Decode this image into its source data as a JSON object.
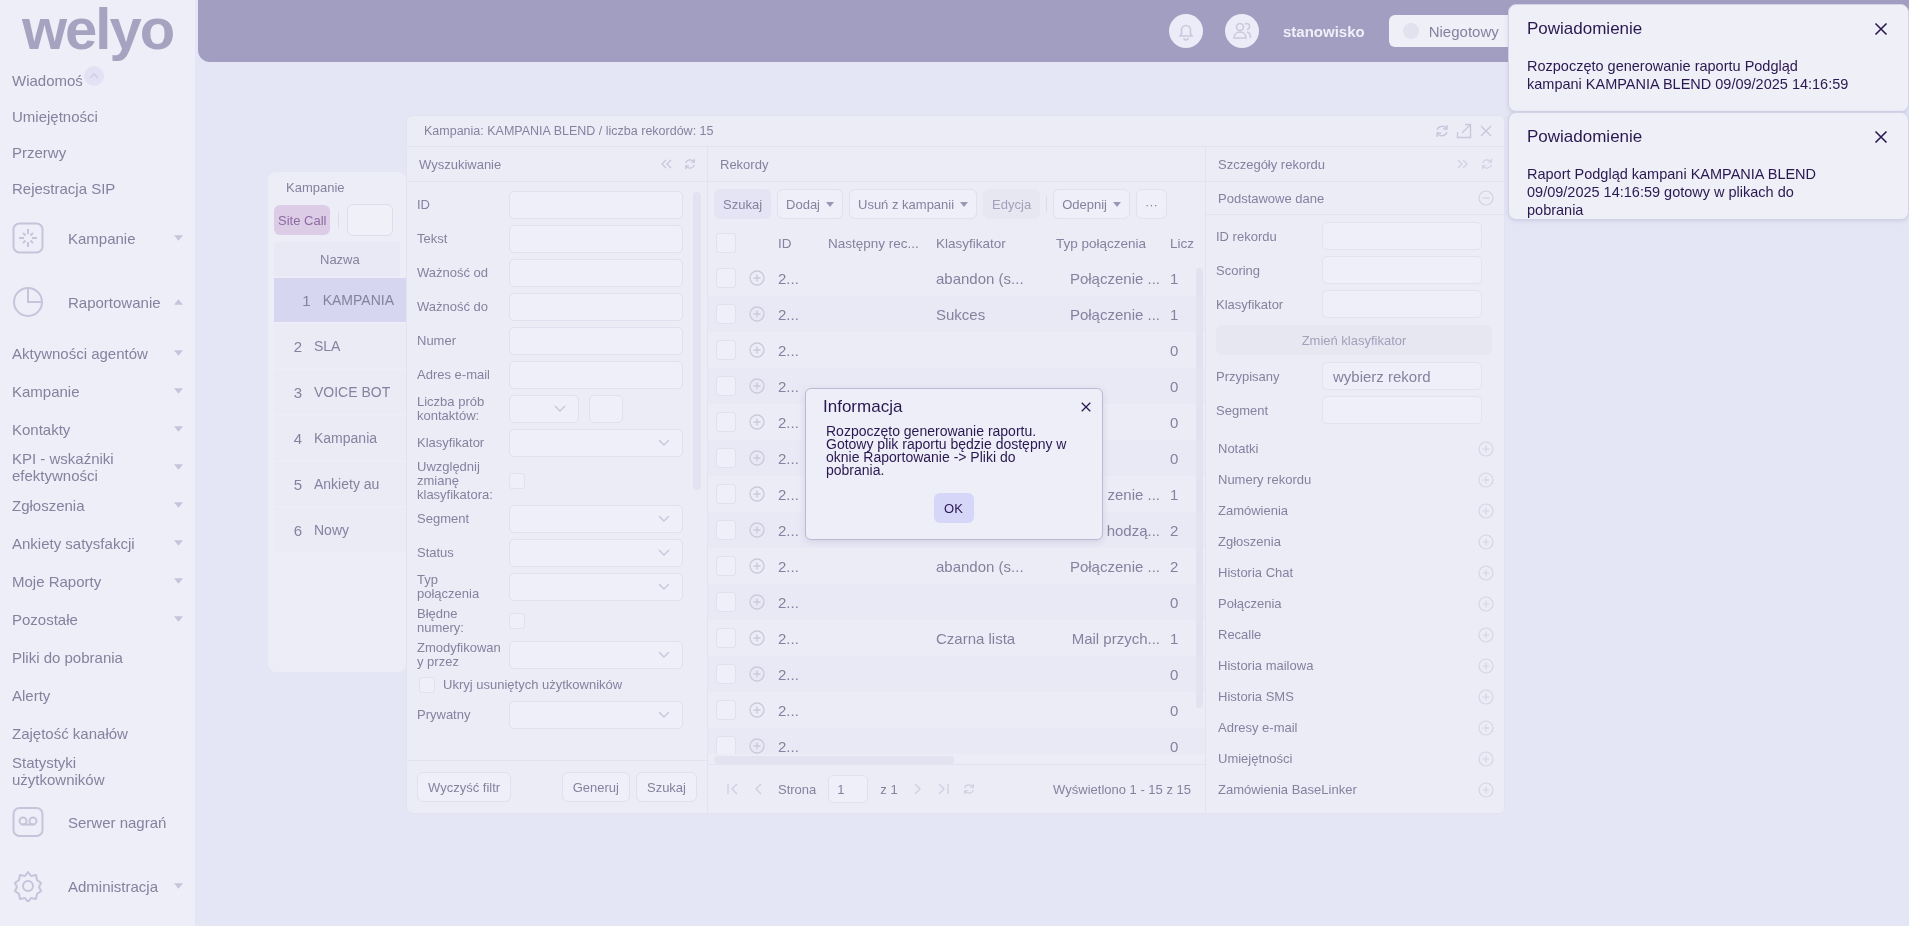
{
  "logo": "welyo",
  "sidebar": {
    "items": [
      {
        "label": "Wiadomoś",
        "kind": "link"
      },
      {
        "label": "Umiejętności",
        "kind": "link"
      },
      {
        "label": "Przerwy",
        "kind": "link"
      },
      {
        "label": "Rejestracja SIP",
        "kind": "link"
      },
      {
        "label": "Kampanie",
        "kind": "group",
        "expanded": false
      },
      {
        "label": "Raportowanie",
        "kind": "group",
        "expanded": true,
        "children": [
          {
            "label": "Aktywności agentów",
            "kind": "menu",
            "expanded": false
          },
          {
            "label": "Kampanie",
            "kind": "menu",
            "expanded": false
          },
          {
            "label": "Kontakty",
            "kind": "menu",
            "expanded": false
          },
          {
            "label": "KPI - wskaźniki efektywności",
            "kind": "menu",
            "expanded": false
          },
          {
            "label": "Zgłoszenia",
            "kind": "menu",
            "expanded": false
          },
          {
            "label": "Ankiety satysfakcji",
            "kind": "menu",
            "expanded": false
          },
          {
            "label": "Moje Raporty",
            "kind": "menu",
            "expanded": false
          },
          {
            "label": "Pozostałe",
            "kind": "menu",
            "expanded": false
          },
          {
            "label": "Pliki do pobrania",
            "kind": "link"
          },
          {
            "label": "Alerty",
            "kind": "link"
          },
          {
            "label": "Zajętość kanałów",
            "kind": "link"
          },
          {
            "label": "Statystyki użytkowników",
            "kind": "link"
          }
        ]
      },
      {
        "label": "Serwer nagrań",
        "kind": "group"
      },
      {
        "label": "Administracja",
        "kind": "group",
        "expanded": false
      }
    ]
  },
  "topbar": {
    "workstation": "stanowisko",
    "status": "Niegotowy"
  },
  "campaigns_panel": {
    "title": "Kampanie",
    "button": "Site Call",
    "column": "Nazwa",
    "rows": [
      {
        "number": "1",
        "name": "KAMPANIA",
        "selected": true
      },
      {
        "number": "2",
        "name": "SLA",
        "selected": false
      },
      {
        "number": "3",
        "name": "VOICE BOT",
        "selected": false
      },
      {
        "number": "4",
        "name": "Kampania",
        "selected": false
      },
      {
        "number": "5",
        "name": "Ankiety au",
        "selected": false
      },
      {
        "number": "6",
        "name": "Nowy",
        "selected": false
      }
    ]
  },
  "window": {
    "title": "Kampania: KAMPANIA BLEND / liczba rekordów: 15",
    "search": {
      "title": "Wyszukiwanie",
      "fields": [
        {
          "label": "ID",
          "kind": "text"
        },
        {
          "label": "Tekst",
          "kind": "text"
        },
        {
          "label": "Ważność od",
          "kind": "text"
        },
        {
          "label": "Ważność do",
          "kind": "text"
        },
        {
          "label": "Numer",
          "kind": "text"
        },
        {
          "label": "Adres e-mail",
          "kind": "text"
        },
        {
          "label": "Liczba prób kontaktów:",
          "kind": "pair"
        },
        {
          "label": "Klasyfikator",
          "kind": "select"
        },
        {
          "label": "Uwzględnij zmianę klasyfikatora:",
          "kind": "checkbox",
          "checked": false
        },
        {
          "label": "Segment",
          "kind": "select"
        },
        {
          "label": "Status",
          "kind": "select"
        },
        {
          "label": "Typ połączenia",
          "kind": "select"
        },
        {
          "label": "Błędne numery:",
          "kind": "checkbox",
          "checked": false
        },
        {
          "label": "Zmodyfikowany przez",
          "kind": "select"
        },
        {
          "label": "Ukryj usuniętych użytkowników",
          "kind": "check_row",
          "checked": false
        },
        {
          "label": "Prywatny",
          "kind": "select"
        }
      ],
      "buttons": [
        "Wyczyść filtr",
        "Generuj",
        "Szukaj"
      ]
    },
    "records": {
      "title": "Rekordy",
      "toolbar": [
        {
          "label": "Szukaj",
          "kind": "primary",
          "disabled": false
        },
        {
          "label": "Dodaj",
          "kind": "dropdown",
          "disabled": false
        },
        {
          "label": "Usuń z kampanii",
          "kind": "dropdown",
          "disabled": false
        },
        {
          "label": "Edycja",
          "kind": "plain",
          "disabled": true
        },
        {
          "kind": "separator"
        },
        {
          "label": "Odepnij",
          "kind": "dropdown",
          "disabled": false
        },
        {
          "label": "···",
          "kind": "plain",
          "disabled": false
        }
      ],
      "select_all_checked": false,
      "columns": [
        "ID",
        "Następny rec...",
        "Klasyfikator",
        "Typ połączenia",
        "Licz"
      ],
      "rows": [
        {
          "checked": false,
          "id": "2...",
          "classifier": "abandon (s...",
          "type": "Połączenie ...",
          "count": "1"
        },
        {
          "checked": false,
          "id": "2...",
          "classifier": "Sukces",
          "type": "Połączenie ...",
          "count": "1"
        },
        {
          "checked": false,
          "id": "2...",
          "count": "0"
        },
        {
          "checked": false,
          "id": "2...",
          "count": "0"
        },
        {
          "checked": false,
          "id": "2...",
          "count": "0"
        },
        {
          "checked": false,
          "id": "2...",
          "count": "0"
        },
        {
          "checked": false,
          "id": "2...",
          "type": "zenie ...",
          "count": "1"
        },
        {
          "checked": false,
          "id": "2...",
          "type": "hodzą...",
          "count": "2"
        },
        {
          "checked": false,
          "id": "2...",
          "classifier": "abandon (s...",
          "type": "Połączenie ...",
          "count": "2"
        },
        {
          "checked": false,
          "id": "2...",
          "count": "0"
        },
        {
          "checked": false,
          "id": "2...",
          "classifier": "Czarna lista",
          "type": "Mail przych...",
          "count": "1"
        },
        {
          "checked": false,
          "id": "2...",
          "count": "0"
        },
        {
          "checked": false,
          "id": "2...",
          "count": "0"
        },
        {
          "checked": false,
          "id": "2...",
          "count": "0"
        }
      ],
      "pager": {
        "label": "Strona",
        "page": "1",
        "of": "z 1",
        "summary": "Wyświetlono 1 - 15 z 15"
      }
    },
    "details": {
      "title": "Szczegóły rekordu",
      "section": "Podstawowe dane",
      "fields": [
        {
          "label": "ID rekordu",
          "kind": "input"
        },
        {
          "label": "Scoring",
          "kind": "input"
        },
        {
          "label": "Klasyfikator",
          "kind": "input"
        },
        {
          "label": "Zmień klasyfikator",
          "kind": "button",
          "disabled": true
        },
        {
          "label": "Przypisany",
          "kind": "input",
          "value": "wybierz rekord"
        },
        {
          "label": "Segment",
          "kind": "input"
        }
      ],
      "sections": [
        "Notatki",
        "Numery rekordu",
        "Zamówienia",
        "Zgłoszenia",
        "Historia Chat",
        "Połączenia",
        "Recalle",
        "Historia mailowa",
        "Historia SMS",
        "Adresy e-mail",
        "Umiejętności",
        "Zamówienia BaseLinker"
      ]
    }
  },
  "dialog": {
    "title": "Informacja",
    "message": "Rozpoczęto generowanie raportu. Gotowy plik raportu będzie dostępny w oknie Raportowanie -> Pliki do pobrania.",
    "button": "OK"
  },
  "notifications": [
    {
      "title": "Powiadomienie",
      "text": "Rozpoczęto generowanie raportu Podgląd kampani KAMPANIA BLEND 09/09/2025 14:16:59"
    },
    {
      "title": "Powiadomienie",
      "text": "Raport Podgląd kampani KAMPANIA BLEND 09/09/2025 14:16:59 gotowy w plikach do pobrania"
    }
  ]
}
